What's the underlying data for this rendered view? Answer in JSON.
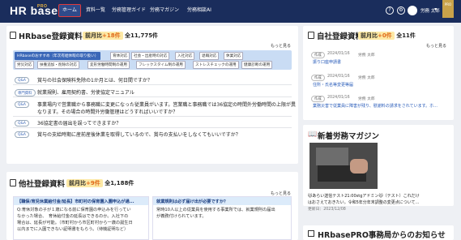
{
  "brand": {
    "name": "HR base",
    "pro": "PRO"
  },
  "nav": [
    {
      "label": "ホーム",
      "active": true
    },
    {
      "label": "資料一覧"
    },
    {
      "label": "労務管理ガイド"
    },
    {
      "label": "労務マガジン"
    },
    {
      "label": "労務相談AI"
    }
  ],
  "user": {
    "name": "労務 太郎"
  },
  "hr_docs": {
    "title": "HRbase登録資料",
    "change_label": "前月比",
    "change": "+18件",
    "total_label": "全",
    "total": "11,775件",
    "more": "もっと見る",
    "tags": [
      "HRbaseのおすすめ（年次有給休暇の取り扱い）",
      "育休対応",
      "社会・出産時の対応",
      "入社対応",
      "退職対応",
      "休業対応",
      "労災対応",
      "扶養追加・削除の対応",
      "変形労働時間制の運用",
      "フレックスタイム制の運用",
      "ストレスチェックの運用",
      "健康診断の運用"
    ],
    "rows": [
      {
        "tag": "Q&A",
        "text": "賞与の社会保険料免除の1か月とは、何日間ですか？"
      },
      {
        "tag": "専門資料",
        "text": "就業規則、雇用契約書、労使協定マニュアル"
      },
      {
        "tag": "Q&A",
        "text": "事業場内で営業職から事務職に変更になった従業員がいます。営業職と事務職では36協定の時間外労働時間の上限が異"
      },
      {
        "tag": "",
        "text": "なります。その場合の時間外労働管理はどうすればいいですか？"
      },
      {
        "tag": "Q&A",
        "text": "36協定書の届出を誤ってできますか？"
      },
      {
        "tag": "Q&A",
        "text": "賞与の支給時期に産前産後休業を取得しているので、賞与の支払いをしなくてもいいですか？"
      }
    ]
  },
  "other_docs": {
    "title": "他社登録資料",
    "change_label": "前月比",
    "change": "+9件",
    "total_label": "全",
    "total": "1,188件",
    "more": "もっと見る",
    "left": {
      "heading": "【職保/育児休業給付金/延長】市町村の保育園入園申込が通...",
      "lines": [
        "Q:育休対象の子が１歳になる前に保育園の申込みを行ってい",
        "なかった場合、　育休給付金の延長はできるのか。入社下の",
        "場合は、延長が可能。（市町村から市区町村から一歳の誕生日",
        "以内までに入園できない証明書をもらう。（待機証明など）"
      ]
    },
    "right": {
      "heading": "就業規則は必ず届け出が必要ですか？",
      "lines": [
        "常時10人以上の従業員を使用する事業所では、就業規則の届出",
        "が義務付けられています。"
      ]
    }
  },
  "company_docs": {
    "title": "自社登録資料",
    "change_label": "前月比",
    "change": "+0件",
    "total_label": "全",
    "total": "11件",
    "more": "もっと見る",
    "items": [
      {
        "tag": "作成",
        "date": "2024/01/16",
        "author": "労務 太郎",
        "link": "振り口座申請書"
      },
      {
        "tag": "作成",
        "date": "2024/01/16",
        "author": "労務 太郎",
        "link": "住所・氏名等変更等届"
      },
      {
        "tag": "作成",
        "date": "2024/01/16",
        "author": "労務 太郎",
        "link": "業務災害で従業員に障害が残り、慰謝料の請求をされています。ホ..."
      }
    ]
  },
  "magazine": {
    "title": "新着労務マガジン",
    "line1": "🐱あらい送信テスト21:00stgアドミン🐱（テスト）これだけ",
    "line2": "はおさえておきたい。令和5年分年末調整の変更点について...",
    "date": "更新日：2023/12/08"
  },
  "news": {
    "title": "HRbasePRO事務局からのお知らせ"
  }
}
